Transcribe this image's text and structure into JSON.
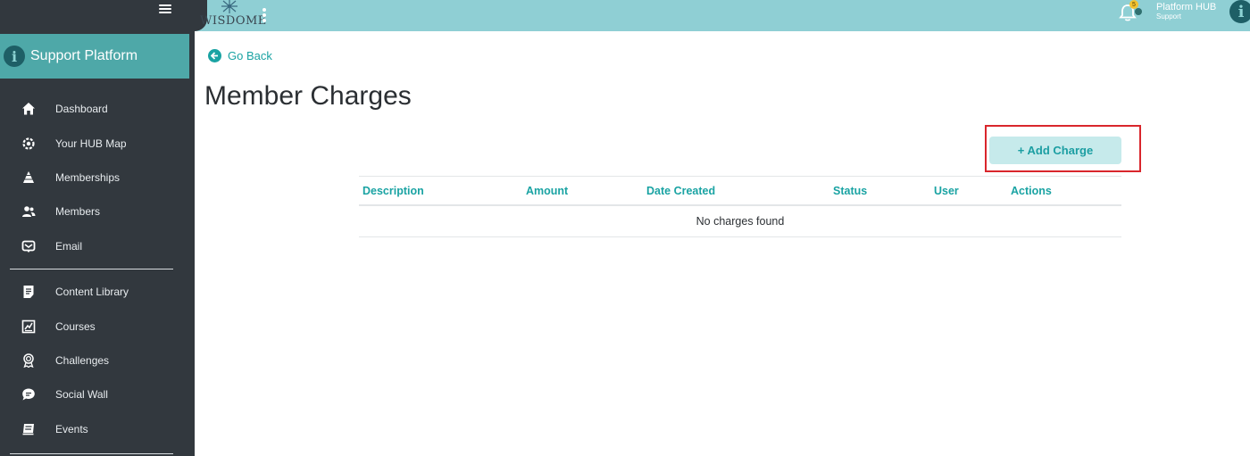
{
  "sidebar": {
    "platform_name": "Support Platform",
    "platform_logo_letter": "i",
    "items": [
      {
        "label": "Dashboard",
        "icon": "home-icon"
      },
      {
        "label": "Your HUB Map",
        "icon": "gear-map-icon"
      },
      {
        "label": "Memberships",
        "icon": "pyramid-icon"
      },
      {
        "label": "Members",
        "icon": "users-icon"
      },
      {
        "label": "Email",
        "icon": "email-icon"
      },
      {
        "label": "Content Library",
        "icon": "document-icon"
      },
      {
        "label": "Courses",
        "icon": "chart-board-icon"
      },
      {
        "label": "Challenges",
        "icon": "award-icon"
      },
      {
        "label": "Social Wall",
        "icon": "chat-bubble-icon"
      },
      {
        "label": "Events",
        "icon": "calendar-icon"
      }
    ]
  },
  "topbar": {
    "brand": "WISDOME",
    "notifications_count": "5",
    "user_name": "Platform HUB",
    "user_role": "Support",
    "avatar_letter": "i"
  },
  "main": {
    "go_back": "Go Back",
    "title": "Member Charges",
    "add_button": "+ Add Charge",
    "table": {
      "columns": [
        "Description",
        "Amount",
        "Date Created",
        "Status",
        "User",
        "Actions"
      ],
      "empty_text": "No charges found"
    }
  },
  "colors": {
    "sidebar_bg": "#32383e",
    "accent": "#1aa3a3",
    "topbar_bg": "#8fcfd4",
    "highlight": "#d9262c"
  }
}
